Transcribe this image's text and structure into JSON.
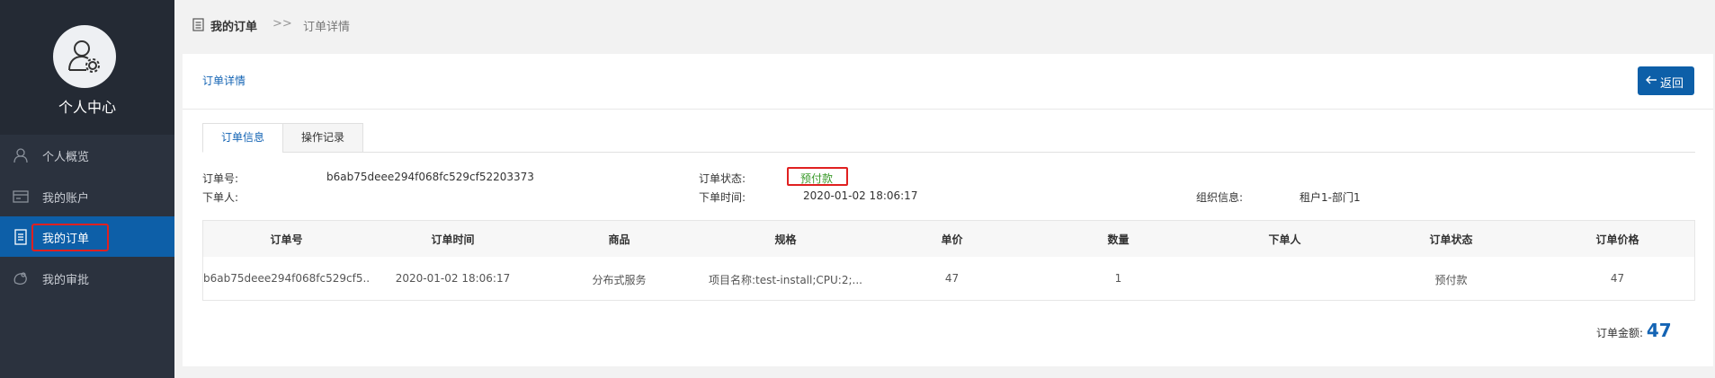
{
  "sidebar": {
    "title": "个人中心",
    "items": [
      {
        "label": "个人概览",
        "icon": "user-outline-icon"
      },
      {
        "label": "我的账户",
        "icon": "card-icon"
      },
      {
        "label": "我的订单",
        "icon": "document-icon",
        "active": true
      },
      {
        "label": "我的审批",
        "icon": "approval-icon"
      }
    ]
  },
  "breadcrumb": {
    "root": "我的订单",
    "separator": ">>",
    "current": "订单详情"
  },
  "card": {
    "title": "订单详情",
    "back_label": "返回"
  },
  "tabs": [
    {
      "label": "订单信息",
      "active": true
    },
    {
      "label": "操作记录",
      "active": false
    }
  ],
  "order_info": {
    "order_no_label": "订单号:",
    "order_no": "b6ab75deee294f068fc529cf52203373",
    "orderer_label": "下单人:",
    "orderer": "",
    "status_label": "订单状态:",
    "status": "预付款",
    "time_label": "下单时间:",
    "time": "2020-01-02 18:06:17",
    "org_label": "组织信息:",
    "org": "租户1-部门1"
  },
  "table": {
    "columns": [
      "订单号",
      "订单时间",
      "商品",
      "规格",
      "单价",
      "数量",
      "下单人",
      "订单状态",
      "订单价格"
    ],
    "rows": [
      [
        "b6ab75deee294f068fc529cf5...",
        "2020-01-02 18:06:17",
        "分布式服务",
        "项目名称:test-install;CPU:2;...",
        "47",
        "1",
        "",
        "预付款",
        "47"
      ]
    ]
  },
  "total": {
    "label": "订单金额:",
    "value": "47"
  },
  "colors": {
    "sidebar_bg": "#2b323e",
    "active_bg": "#0d5fa8",
    "accent": "#1464b4",
    "highlight": "#e02020",
    "status_green": "#3a9a2a"
  }
}
